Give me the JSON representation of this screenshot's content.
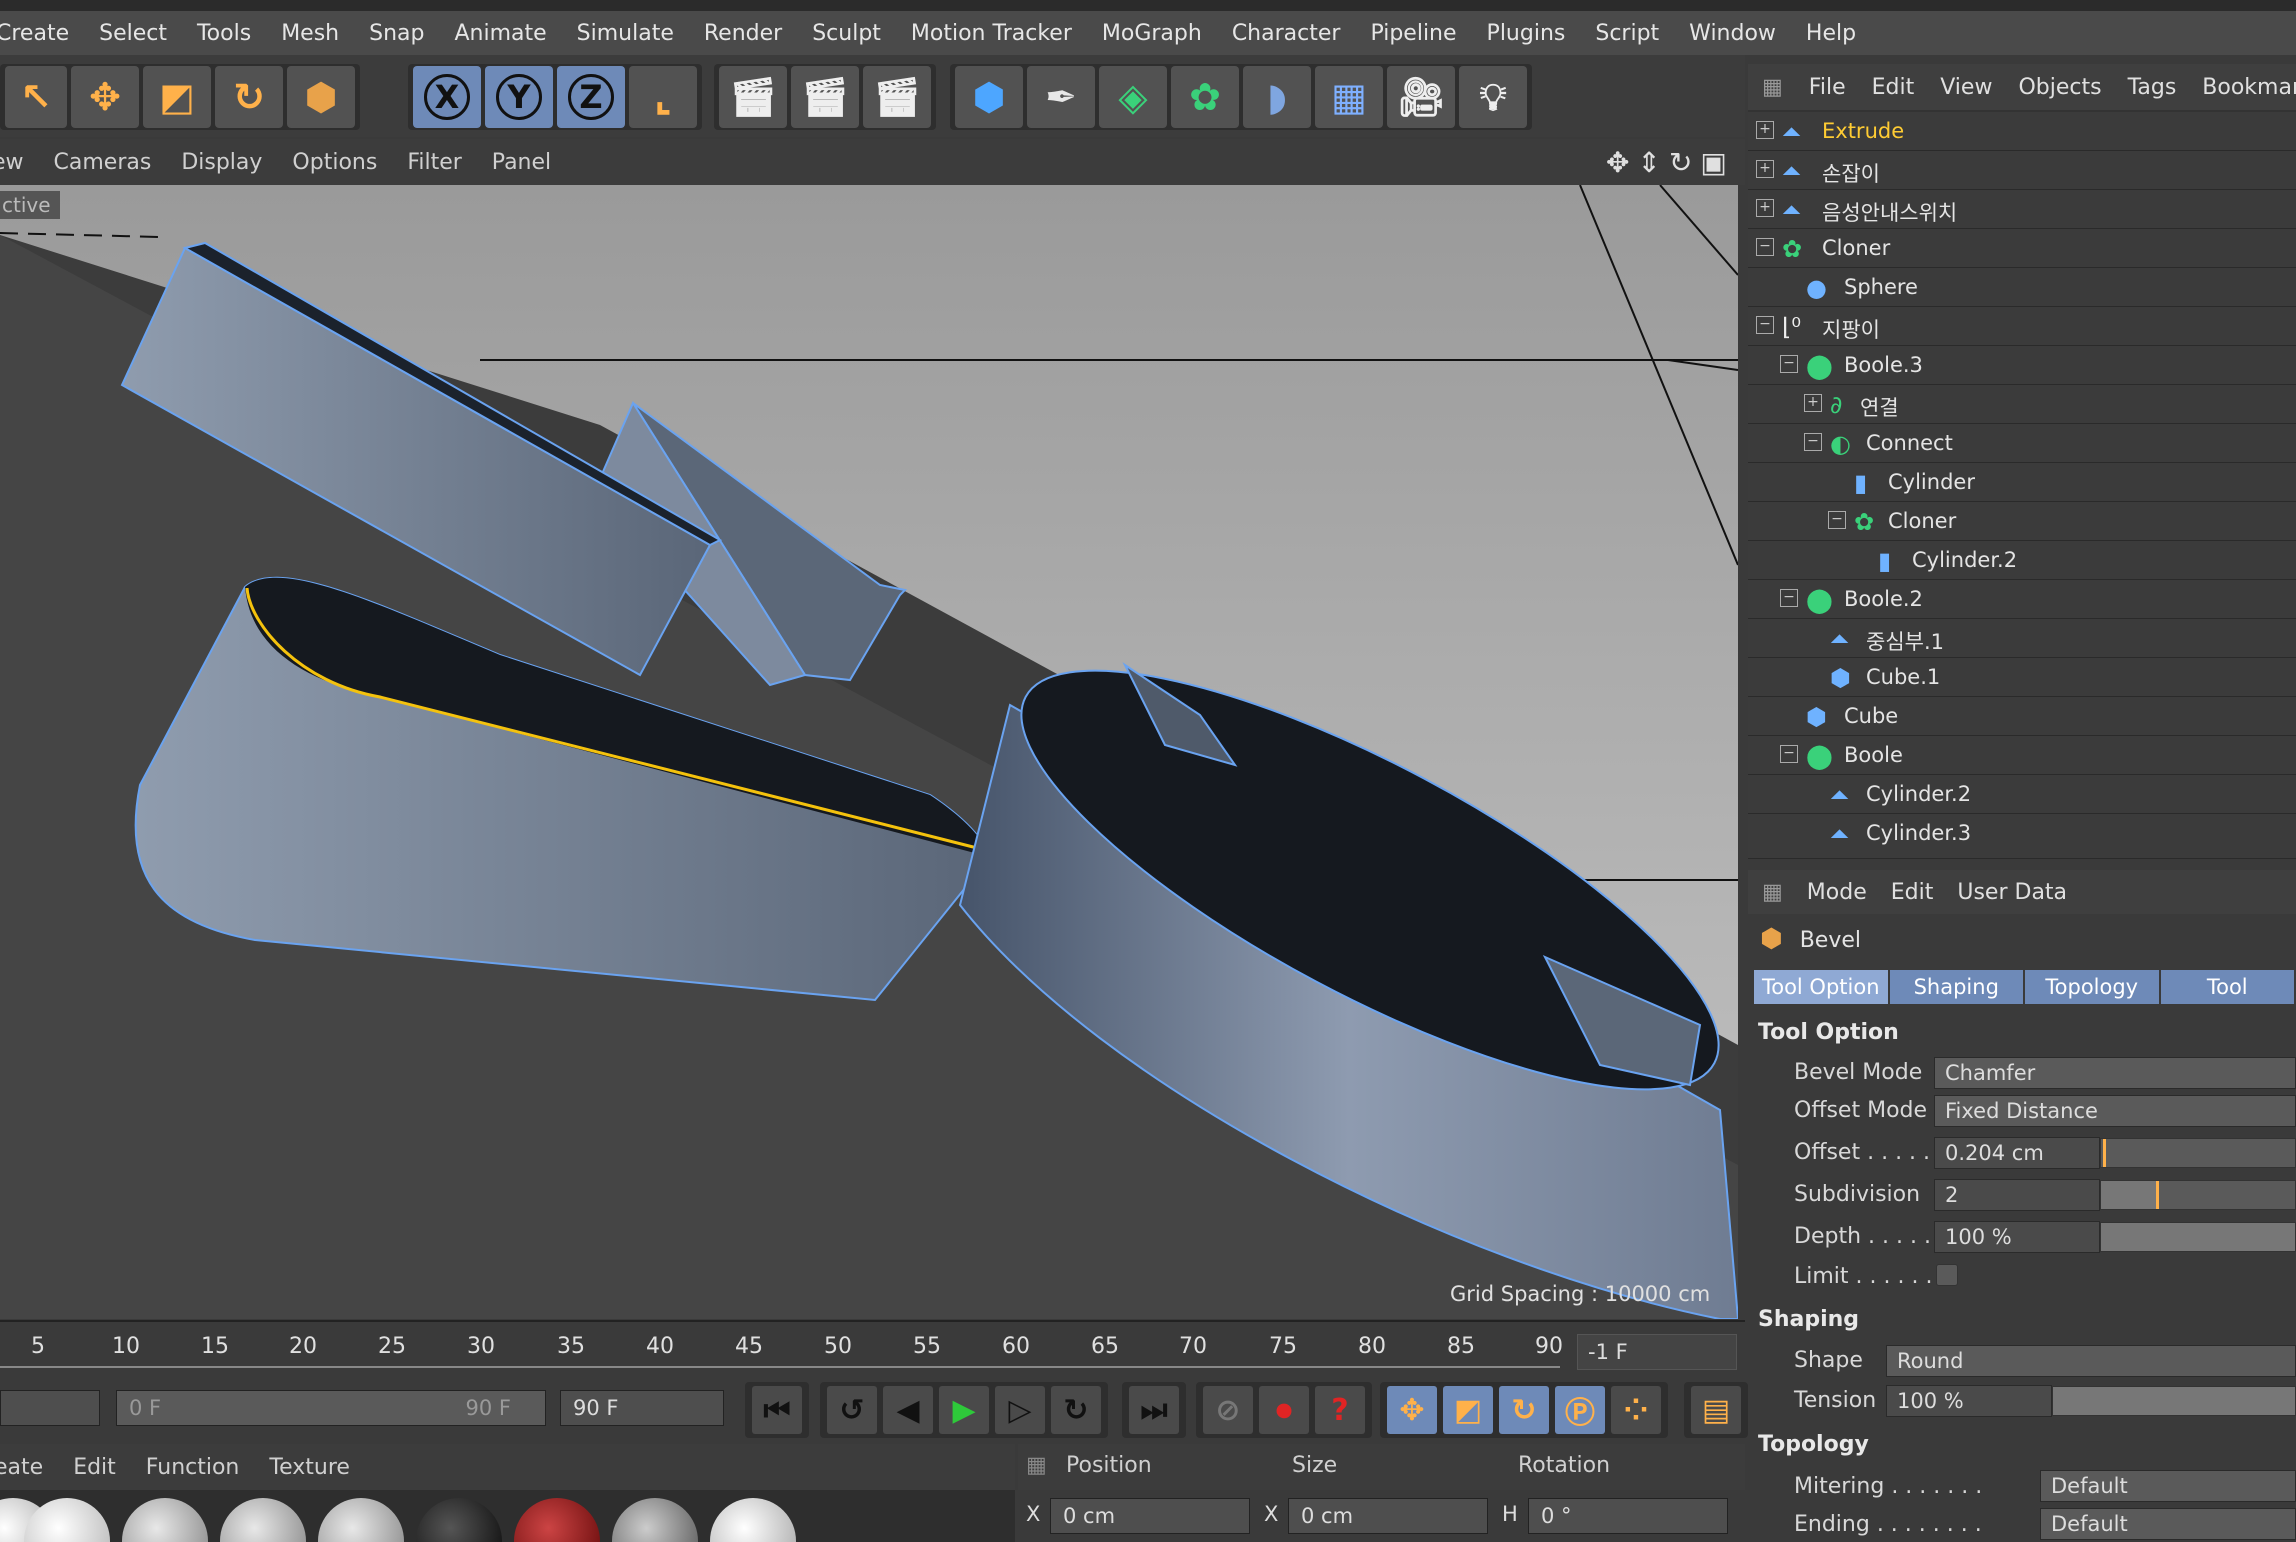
{
  "menubar": [
    "Create",
    "Select",
    "Tools",
    "Mesh",
    "Snap",
    "Animate",
    "Simulate",
    "Render",
    "Sculpt",
    "Motion Tracker",
    "MoGraph",
    "Character",
    "Pipeline",
    "Plugins",
    "Script",
    "Window",
    "Help"
  ],
  "toolbar": {
    "axis_x": "X",
    "axis_y": "Y",
    "axis_z": "Z"
  },
  "viewport": {
    "menu": [
      "ew",
      "Cameras",
      "Display",
      "Options",
      "Filter",
      "Panel"
    ],
    "label": "ctive",
    "grid_spacing": "Grid Spacing : 10000 cm"
  },
  "timeline": {
    "ticks": [
      "5",
      "10",
      "15",
      "20",
      "25",
      "30",
      "35",
      "40",
      "45",
      "50",
      "55",
      "60",
      "65",
      "70",
      "75",
      "80",
      "85",
      "90"
    ],
    "current_frame": "-1 F",
    "range_start": "0 F",
    "range_end": "90 F",
    "end_field": "90 F"
  },
  "material_manager": {
    "menu": [
      "eate",
      "Edit",
      "Function",
      "Texture"
    ]
  },
  "coordinates": {
    "headers": [
      "Position",
      "Size",
      "Rotation"
    ],
    "x_label": "X",
    "x_pos": "0 cm",
    "x_size_label": "X",
    "x_size": "0 cm",
    "h_label": "H",
    "h_rot": "0 °"
  },
  "object_manager": {
    "menu": [
      "File",
      "Edit",
      "View",
      "Objects",
      "Tags",
      "Bookmar"
    ],
    "rows": [
      {
        "name": "Extrude",
        "active": true
      },
      {
        "name": "손잡이"
      },
      {
        "name": "음성안내스위치"
      },
      {
        "name": "Cloner"
      },
      {
        "name": "Sphere"
      },
      {
        "name": "지팡이"
      },
      {
        "name": "Boole.3"
      },
      {
        "name": "연결"
      },
      {
        "name": "Connect"
      },
      {
        "name": "Cylinder"
      },
      {
        "name": "Cloner"
      },
      {
        "name": "Cylinder.2"
      },
      {
        "name": "Boole.2"
      },
      {
        "name": "중심부.1"
      },
      {
        "name": "Cube.1"
      },
      {
        "name": "Cube"
      },
      {
        "name": "Boole"
      },
      {
        "name": "Cylinder.2"
      },
      {
        "name": "Cylinder.3"
      }
    ]
  },
  "attribute_manager": {
    "menu": [
      "Mode",
      "Edit",
      "User Data"
    ],
    "title": "Bevel",
    "tabs": [
      "Tool Option",
      "Shaping",
      "Topology",
      "Tool"
    ],
    "section_tool_option": "Tool Option",
    "bevel_mode_label": "Bevel Mode",
    "bevel_mode": "Chamfer",
    "offset_mode_label": "Offset Mode",
    "offset_mode": "Fixed Distance",
    "offset_label": "Offset . . . . .",
    "offset": "0.204 cm",
    "subdivision_label": "Subdivision",
    "subdivision": "2",
    "depth_label": "Depth . . . . . .",
    "depth": "100 %",
    "limit_label": "Limit . . . . . . .",
    "section_shaping": "Shaping",
    "shape_label": "Shape",
    "shape": "Round",
    "tension_label": "Tension",
    "tension": "100 %",
    "section_topology": "Topology",
    "mitering_label": "Mitering . . . . . . .",
    "mitering": "Default",
    "ending_label": "Ending . . . . . . . .",
    "ending": "Default"
  },
  "colors": {
    "accent": "#ffb14a",
    "selection": "#6e8ab8",
    "active_object": "#ffcc33"
  }
}
